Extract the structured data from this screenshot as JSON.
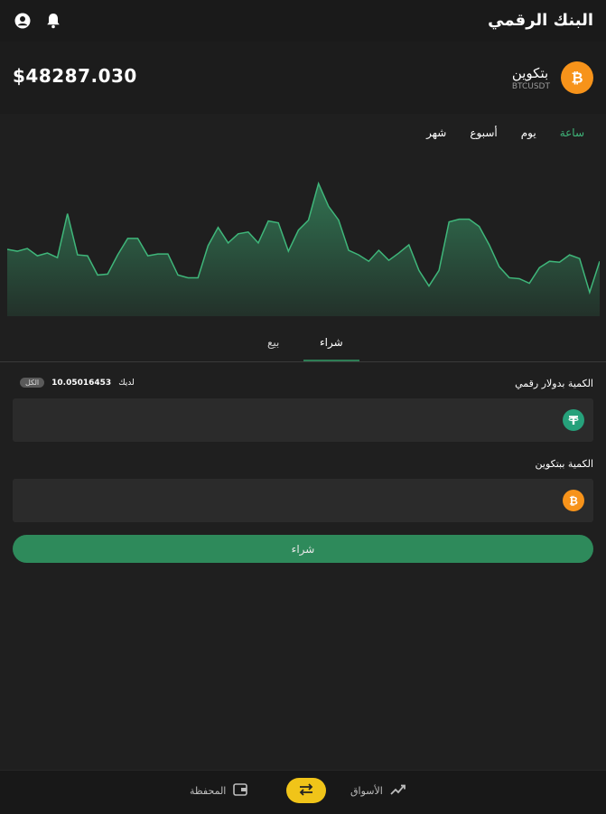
{
  "header": {
    "title": "البنك الرقمي"
  },
  "ticker": {
    "price": "$48287.030",
    "coin_name": "بتكوين",
    "pair": "BTCUSDT"
  },
  "ranges": {
    "items": [
      "ساعة",
      "يوم",
      "أسبوع",
      "شهر"
    ],
    "active": "ساعة"
  },
  "chart_data": {
    "type": "area",
    "color": "#3fb67a",
    "values": [
      73,
      71,
      74,
      66,
      69,
      64,
      112,
      67,
      66,
      45,
      46,
      67,
      85,
      85,
      66,
      68,
      68,
      45,
      42,
      42,
      77,
      97,
      80,
      90,
      92,
      80,
      104,
      102,
      71,
      94,
      105,
      145,
      120,
      105,
      72,
      67,
      60,
      72,
      61,
      69,
      78,
      50,
      33,
      50,
      103,
      106,
      106,
      98,
      78,
      54,
      42,
      41,
      36,
      53,
      60,
      59,
      67,
      63,
      26,
      60
    ]
  },
  "tabs": {
    "buy": "شراء",
    "sell": "بيع",
    "active": "buy"
  },
  "usd_field": {
    "label": "الكمية بدولار رقمي",
    "value": "",
    "placeholder": ""
  },
  "balance": {
    "prefix": "لديك",
    "value": "10.05016453",
    "max_label": "الكل"
  },
  "btc_field": {
    "label": "الكمية ببتكوين",
    "value": "",
    "placeholder": ""
  },
  "buy_button": {
    "label": "شراء"
  },
  "nav": {
    "markets": "الأسواق",
    "wallet": "المحفظة"
  },
  "colors": {
    "accent": "#2e8a5b",
    "bitcoin": "#f7931a",
    "tether": "#26a17b",
    "swap": "#f0c419"
  }
}
